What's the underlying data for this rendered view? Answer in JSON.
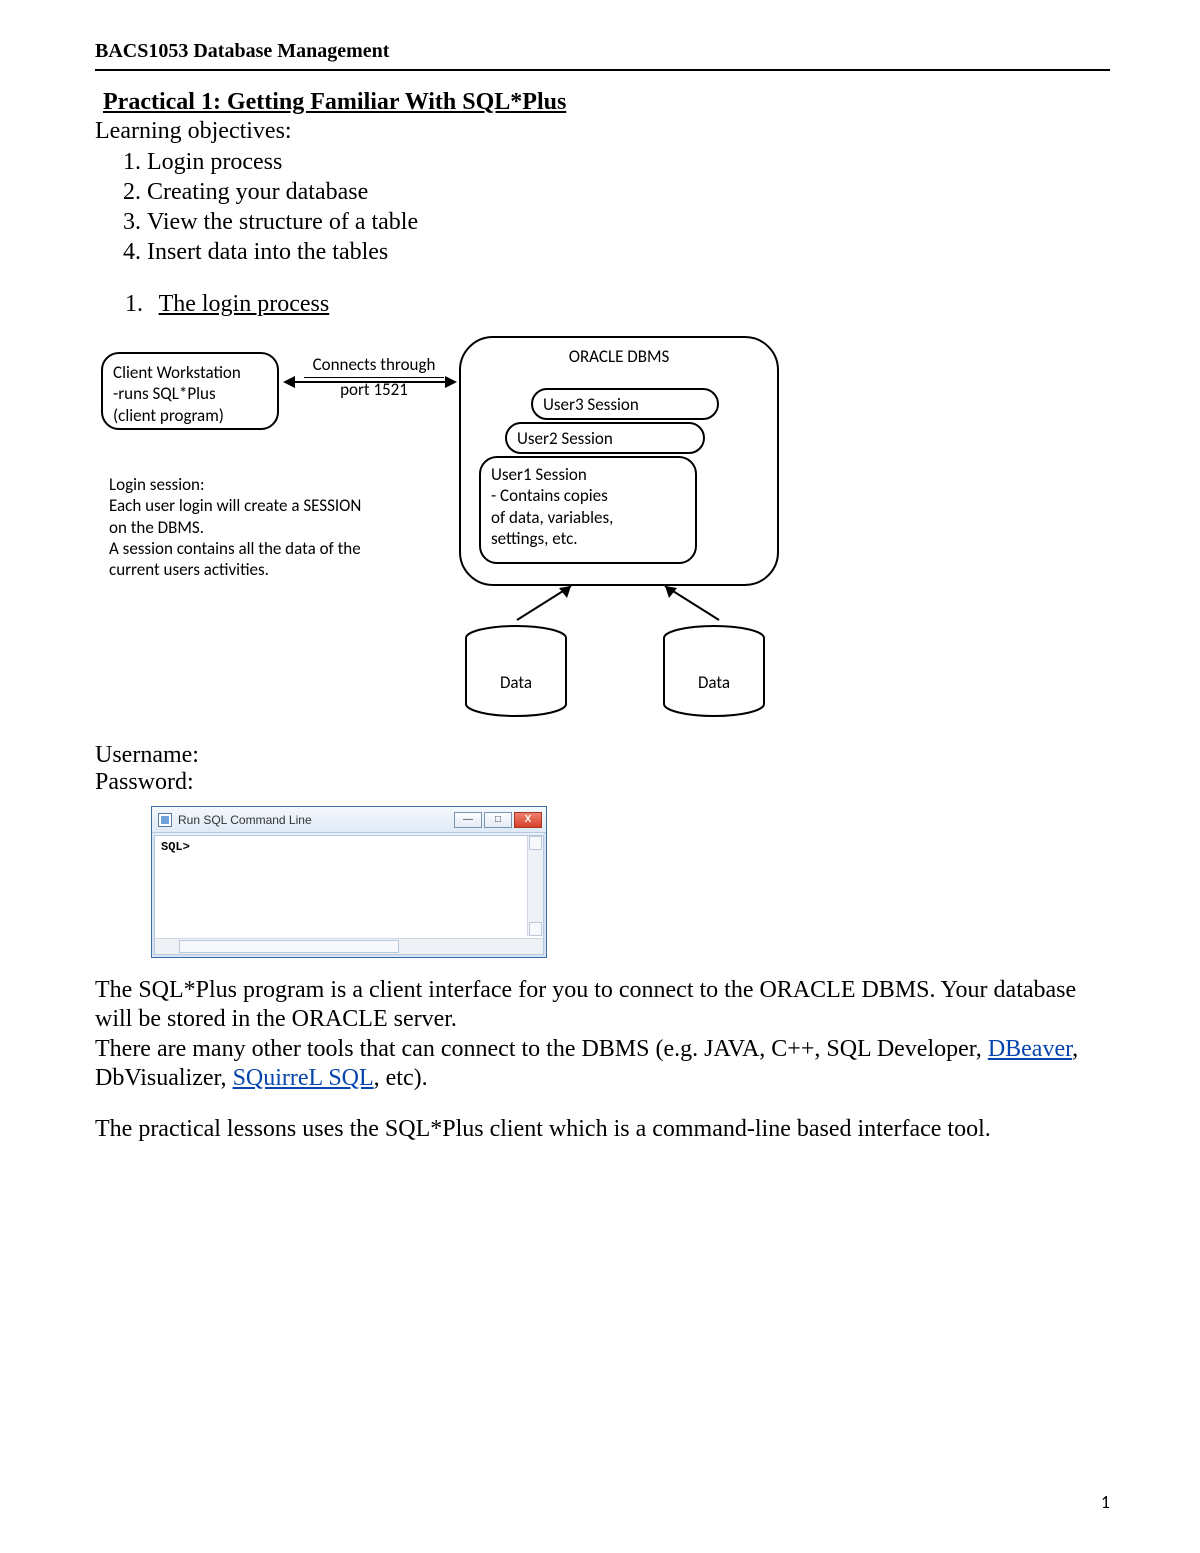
{
  "header": {
    "course": "BACS1053 Database Management"
  },
  "title": "Practical 1: Getting Familiar With SQL*Plus",
  "objectives": {
    "lead": "Learning objectives:",
    "items": [
      "Login process",
      "Creating your database",
      "View the structure of a table",
      "Insert data into the tables"
    ]
  },
  "section1": {
    "number": "1.",
    "heading": "The login process"
  },
  "diagram": {
    "client": {
      "line1": "Client Workstation",
      "line2": "-runs SQL*Plus",
      "line3": "(client program)"
    },
    "connection": {
      "line1": "Connects through",
      "line2": "port 1521"
    },
    "container_label": "ORACLE DBMS",
    "sessions": {
      "s3": "User3 Session",
      "s2": "User2 Session",
      "s1": {
        "title": "User1 Session",
        "l2": "- Contains copies",
        "l3": "  of data, variables,",
        "l4": "  settings, etc."
      }
    },
    "login_note": {
      "l1": "Login session:",
      "l2": "Each user login will create a SESSION",
      "l3": "on the DBMS.",
      "l4": "A session contains all the data of the",
      "l5": "current users activities."
    },
    "cylinders": {
      "left": "Data",
      "right": "Data"
    }
  },
  "credentials": {
    "username_label": "Username:",
    "password_label": "Password:"
  },
  "sql_window": {
    "title": "Run SQL Command Line",
    "prompt": "SQL>",
    "min": "—",
    "max": "□",
    "close": "X"
  },
  "body": {
    "p1a": "The SQL*Plus program is a client interface for you to connect to the ORACLE DBMS. Your database will be stored in the ORACLE server.",
    "p2a": "There are many other tools that can connect to the DBMS (e.g. JAVA, C++, SQL Developer, ",
    "link1": "DBeaver",
    "p2b": ", DbVisualizer, ",
    "link2": "SQuirreL SQL",
    "p2c": ", etc).",
    "p3": "The practical lessons uses the SQL*Plus client which is a command-line based interface tool."
  },
  "page_number": "1"
}
